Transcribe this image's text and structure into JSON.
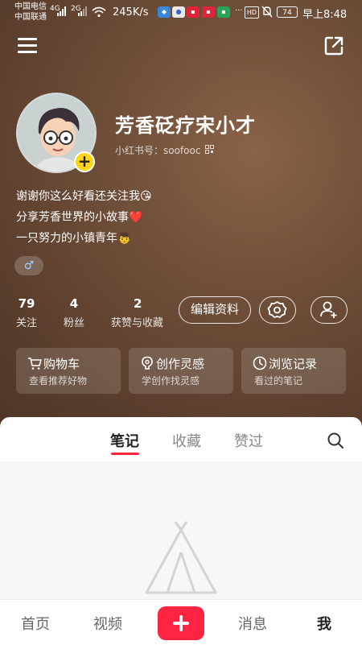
{
  "status_bar": {
    "carrier1": "中国电信",
    "carrier2": "中国联通",
    "sig1": "4G",
    "sig2": "2G",
    "speed": "245K/s",
    "hd": "HD",
    "battery": "74",
    "time": "早上8:48"
  },
  "profile": {
    "nickname": "芳香砭疗宋小才",
    "redid": "小红书号：soofooc",
    "bio": [
      "谢谢你这么好看还关注我😘",
      "分享芳香世界的小故事❤️",
      "一只努力的小镇青年👦"
    ],
    "gender": "♂"
  },
  "stats": [
    {
      "num": "79",
      "label": "关注"
    },
    {
      "num": "4",
      "label": "粉丝"
    },
    {
      "num": "2",
      "label": "获赞与收藏"
    }
  ],
  "actions": {
    "edit": "编辑资料"
  },
  "cards": [
    {
      "title": "购物车",
      "sub": "查看推荐好物",
      "icon": "cart-icon"
    },
    {
      "title": "创作灵感",
      "sub": "学创作找灵感",
      "icon": "lightbulb-icon"
    },
    {
      "title": "浏览记录",
      "sub": "看过的笔记",
      "icon": "clock-icon"
    }
  ],
  "tabs": [
    "笔记",
    "收藏",
    "赞过"
  ],
  "nav": [
    "首页",
    "视频",
    "消息",
    "我"
  ],
  "colors": {
    "accent": "#ff2442",
    "badge": "#ffd51a"
  }
}
